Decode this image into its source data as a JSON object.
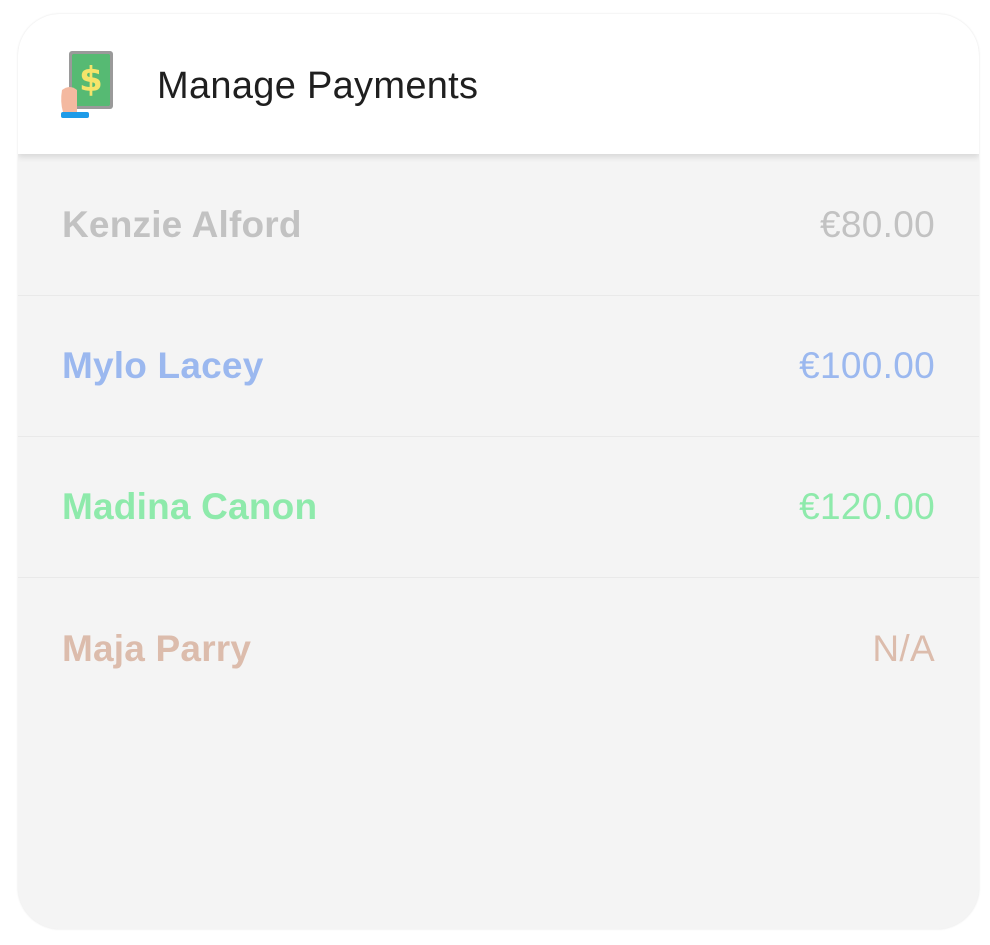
{
  "header": {
    "title": "Manage Payments",
    "icon": "payment-phone-icon"
  },
  "payments": [
    {
      "name": "Kenzie Alford",
      "amount": "€80.00",
      "color": "#c2c2c2"
    },
    {
      "name": "Mylo Lacey",
      "amount": "€100.00",
      "color": "#9bb8ef"
    },
    {
      "name": "Madina Canon",
      "amount": "€120.00",
      "color": "#8eeaab"
    },
    {
      "name": "Maja Parry",
      "amount": "N/A",
      "color": "#dcbcac"
    }
  ]
}
